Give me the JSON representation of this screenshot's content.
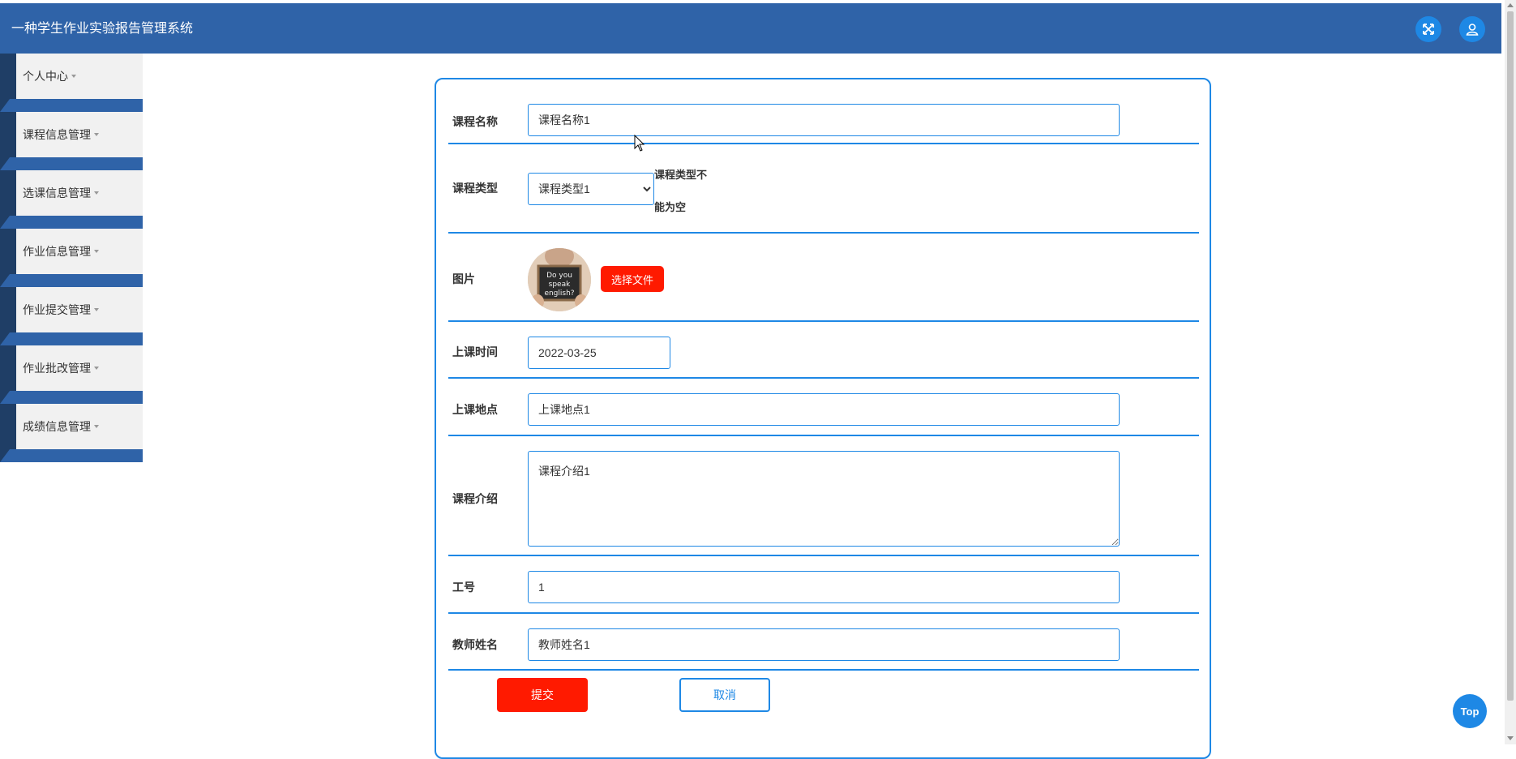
{
  "header": {
    "title": "一种学生作业实验报告管理系统",
    "icons": [
      "fullscreen-icon",
      "user-icon"
    ]
  },
  "sidebar": {
    "items": [
      {
        "label": "个人中心"
      },
      {
        "label": "课程信息管理"
      },
      {
        "label": "选课信息管理"
      },
      {
        "label": "作业信息管理"
      },
      {
        "label": "作业提交管理"
      },
      {
        "label": "作业批改管理"
      },
      {
        "label": "成绩信息管理"
      }
    ]
  },
  "form": {
    "course_name": {
      "label": "课程名称",
      "value": "课程名称1"
    },
    "course_type": {
      "label": "课程类型",
      "value": "课程类型1",
      "error": "课程类型不能为空"
    },
    "image": {
      "label": "图片",
      "button": "选择文件",
      "image_text": "Do you speak english?"
    },
    "class_time": {
      "label": "上课时间",
      "value": "2022-03-25"
    },
    "location": {
      "label": "上课地点",
      "value": "上课地点1"
    },
    "intro": {
      "label": "课程介绍",
      "value": "课程介绍1"
    },
    "job_no": {
      "label": "工号",
      "value": "1"
    },
    "teacher": {
      "label": "教师姓名",
      "value": "教师姓名1"
    },
    "submit_label": "提交",
    "cancel_label": "取消"
  },
  "top_button": "Top",
  "colors": {
    "header": "#2f63a8",
    "sidebar_dark": "#1f3e66",
    "accent": "#1e88e5",
    "danger": "#ff1a00"
  }
}
